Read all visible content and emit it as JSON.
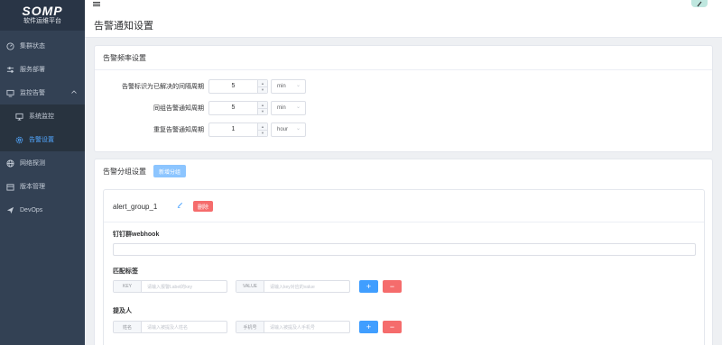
{
  "app": {
    "logo_title": "SOMP",
    "logo_subtitle": "软件运维平台"
  },
  "sidebar": {
    "items": [
      {
        "label": "集群状态",
        "icon": "gauge-icon"
      },
      {
        "label": "服务部署",
        "icon": "sliders-icon"
      },
      {
        "label": "监控告警",
        "icon": "monitor-icon",
        "expanded": true
      },
      {
        "label": "系统监控",
        "icon": "desktop-icon"
      },
      {
        "label": "告警设置",
        "icon": "gear-icon",
        "active": true
      },
      {
        "label": "网络探测",
        "icon": "globe-icon"
      },
      {
        "label": "版本管理",
        "icon": "package-icon"
      },
      {
        "label": "DevOps",
        "icon": "send-icon"
      }
    ]
  },
  "header": {
    "page_title": "告警通知设置"
  },
  "frequency": {
    "title": "告警频率设置",
    "rows": [
      {
        "label": "告警标识为已解决的间隔周期",
        "value": "5",
        "unit": "min"
      },
      {
        "label": "同组告警通知周期",
        "value": "5",
        "unit": "min"
      },
      {
        "label": "重复告警通知周期",
        "value": "1",
        "unit": "hour"
      }
    ]
  },
  "groups": {
    "title": "告警分组设置",
    "add_button": "新增分组",
    "group": {
      "name": "alert_group_1",
      "delete_button": "删除",
      "webhook_label": "钉钉群webhook",
      "webhook_value": "",
      "labels_label": "匹配标签",
      "key_prepend": "KEY",
      "key_placeholder": "请输入报警Label的key",
      "value_prepend": "VALUE",
      "value_placeholder": "请输入key对应的value",
      "mentions_label": "提及人",
      "name_prepend": "姓名",
      "name_placeholder": "请输入被提及人姓名",
      "phone_prepend": "手机号",
      "phone_placeholder": "请输入被提及人手机号",
      "add_symbol": "+",
      "remove_symbol": "−"
    }
  },
  "colors": {
    "sidebar_bg": "#334154",
    "accent": "#409eff",
    "danger": "#f56c6c"
  }
}
